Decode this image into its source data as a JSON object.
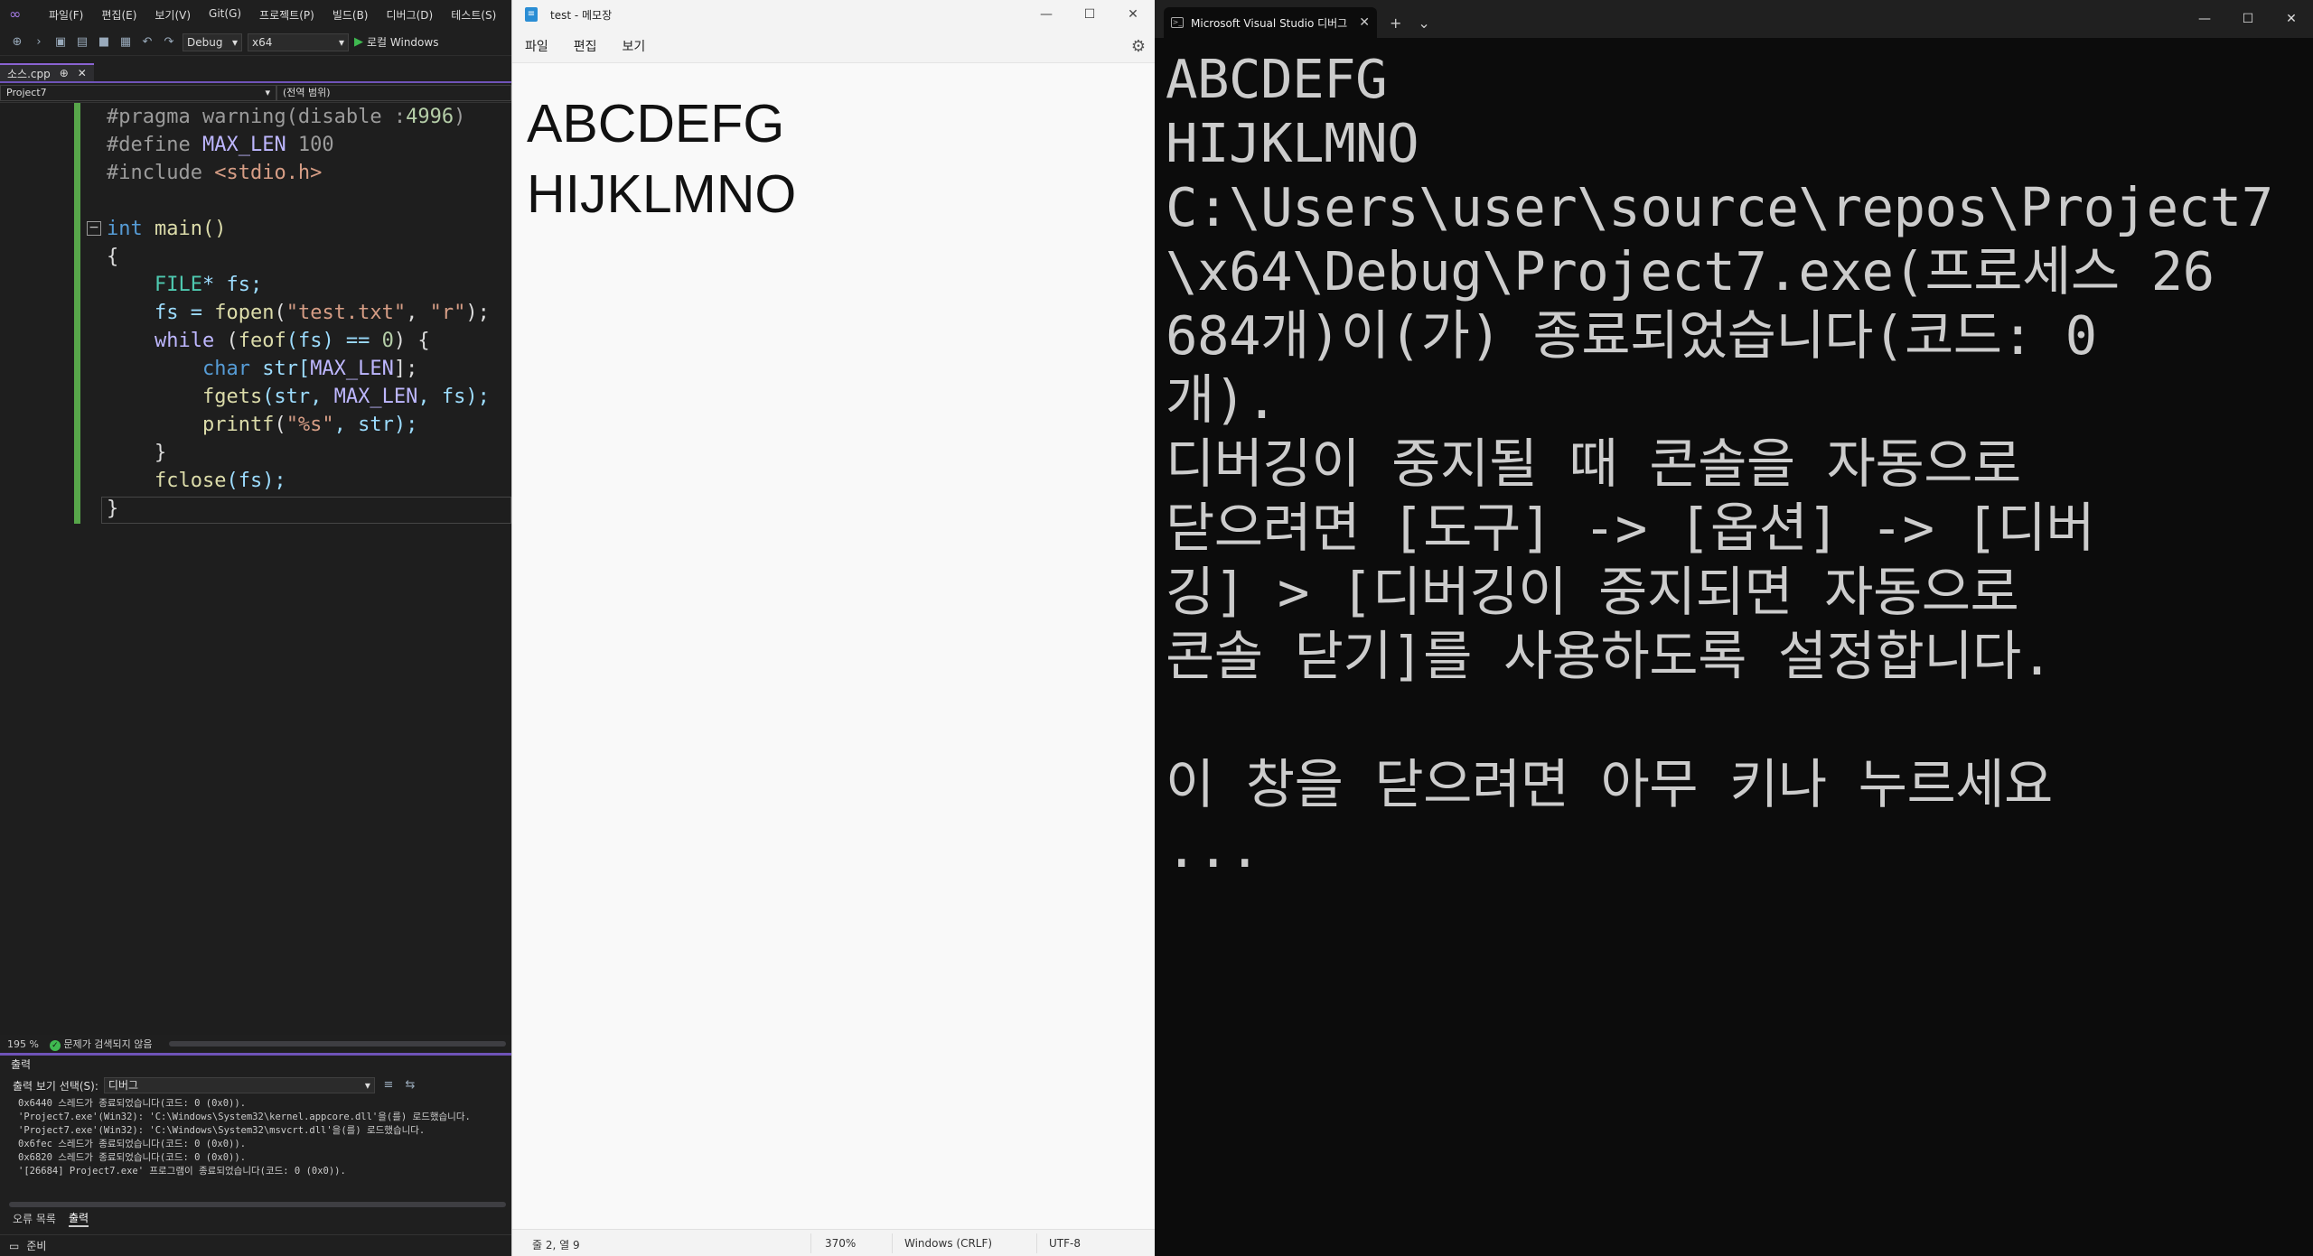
{
  "vs": {
    "menu": [
      "파일(F)",
      "편집(E)",
      "보기(V)",
      "Git(G)",
      "프로젝트(P)",
      "빌드(B)",
      "디버그(D)",
      "테스트(S)"
    ],
    "toolbar": {
      "config": "Debug",
      "platform": "x64",
      "run_label": "로컬 Windows"
    },
    "tab": {
      "filename": "소스.cpp",
      "pin": "⊕",
      "close": "✕"
    },
    "nav": {
      "project": "Project7",
      "scope": "(전역 범위)"
    },
    "editor": {
      "zoom": "195 %",
      "issues": "문제가 검색되지 않음"
    },
    "output": {
      "title": "출력",
      "source_label": "출력 보기 선택(S):",
      "source_value": "디버그",
      "lines": [
        "0x6440 스레드가 종료되었습니다(코드: 0 (0x0)).",
        "'Project7.exe'(Win32): 'C:\\Windows\\System32\\kernel.appcore.dll'을(를) 로드했습니다.",
        "'Project7.exe'(Win32): 'C:\\Windows\\System32\\msvcrt.dll'을(를) 로드했습니다.",
        "0x6fec 스레드가 종료되었습니다(코드: 0 (0x0)).",
        "0x6820 스레드가 종료되었습니다(코드: 0 (0x0)).",
        "'[26684] Project7.exe' 프로그램이 종료되었습니다(코드: 0 (0x0))."
      ]
    },
    "bottom_tabs": [
      "오류 목록",
      "출력"
    ],
    "status": "준비"
  },
  "code": {
    "l1a": "#pragma warning(disable :",
    "l1b": "4996",
    "l1c": ")",
    "l2a": "#define ",
    "l2b": "MAX_LEN",
    "l2c": " 100",
    "l3a": "#include ",
    "l3b": "<stdio.h>",
    "l5a": "int",
    "l5b": " main()",
    "l6": "{",
    "l7a": "    FILE",
    "l7b": "* fs;",
    "l8a": "    fs = ",
    "l8b": "fopen",
    "l8c": "(",
    "l8d": "\"test.txt\"",
    "l8e": ", ",
    "l8f": "\"r\"",
    "l8g": ");",
    "l9a": "    while",
    "l9b": " (",
    "l9c": "feof",
    "l9d": "(fs) == ",
    "l9e": "0",
    "l9f": ") {",
    "l10a": "        char",
    "l10b": " str[",
    "l10c": "MAX_LEN",
    "l10d": "];",
    "l11a": "        fgets",
    "l11b": "(str, ",
    "l11c": "MAX_LEN",
    "l11d": ", fs);",
    "l12a": "        printf",
    "l12b": "(",
    "l12c": "\"%s\"",
    "l12d": ", str);",
    "l13": "    }",
    "l14a": "    fclose",
    "l14b": "(fs);",
    "l15": "}"
  },
  "notepad": {
    "title": "test - 메모장",
    "menu": [
      "파일",
      "편집",
      "보기"
    ],
    "lines": [
      "ABCDEFG",
      "HIJKLMNO"
    ],
    "status": {
      "position": "줄 2, 열 9",
      "zoom": "370%",
      "eol": "Windows (CRLF)",
      "encoding": "UTF-8"
    }
  },
  "terminal": {
    "tab_title": "Microsoft Visual Studio 디버그",
    "lines": [
      "ABCDEFG",
      "HIJKLMNO",
      "C:\\Users\\user\\source\\repos\\Project7",
      "\\x64\\Debug\\Project7.exe(프로세스 26",
      "684개)이(가) 종료되었습니다(코드: 0",
      "개).",
      "디버깅이 중지될 때 콘솔을 자동으로",
      "닫으려면 [도구] -> [옵션] -> [디버",
      "깅] > [디버깅이 중지되면 자동으로",
      "콘솔 닫기]를 사용하도록 설정합니다.",
      "",
      "이 창을 닫으려면 아무 키나 누르세요",
      "..."
    ]
  }
}
